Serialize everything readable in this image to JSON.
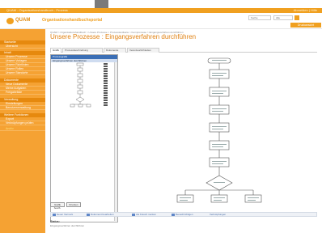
{
  "window": {
    "title": "QUAM - Organisationshandbuch - Prozess"
  },
  "header": {
    "brand": "QUAM",
    "portal_title": "Organisationshandbuchsportal",
    "search_placeholder": "Suche",
    "select_value": "Alle",
    "orange_button": "Druckansicht",
    "top_right": "Abmelden | Hilfe"
  },
  "sidebar": {
    "sections": [
      {
        "label": "Startseite",
        "items": [
          "Übersicht"
        ]
      },
      {
        "label": "Inhalt",
        "items": [
          "Unsere Prozesse",
          "Unsere Vorlagen",
          "Unsere Richtlinien",
          "Unsere Rollen",
          "Unsere Standorte"
        ]
      },
      {
        "label": "Dokumente",
        "items": [
          "Neue Dokumente",
          "Meine Aufgaben",
          "Freigabeliste"
        ]
      },
      {
        "label": "Verwaltung",
        "items": [
          "Einstellungen",
          "Benutzerverwaltung"
        ]
      },
      {
        "label": "Weitere Funktionen",
        "items": [
          "Export",
          "Verknüpfungen prüfen",
          "Archiv"
        ]
      }
    ]
  },
  "main": {
    "breadcrumb": "QUAM > Organisationshandbuch > Unsere Prozesse > Prozesslandkarte > Kernprozesse > Eingangsverfahren durchführen",
    "page_title": "Unsere Prozesse : Eingangsverfahren durchführen",
    "tabs": [
      "Grafik",
      "Prozessbeschreibung",
      "Dokumente",
      "Verantwortlichkeiten"
    ],
    "tree": {
      "header": "Prozessgrafik",
      "selected": "Eingangsverfahren durchführen"
    },
    "buttons": {
      "edit": "Grafik bearb.",
      "print": "Drucken"
    },
    "footer_links": [
      "Neuer Vermerk",
      "Dokument bearbeiten",
      "Als Favorit merken",
      "Benachrichtigen",
      "Verknüpfungen"
    ],
    "meta": {
      "title": "Status:",
      "text": "Eingangsverfahren durchführen"
    }
  },
  "colors": {
    "accent": "#f0a020",
    "sidebar": "#f5a233",
    "link": "#4b6ea8"
  }
}
